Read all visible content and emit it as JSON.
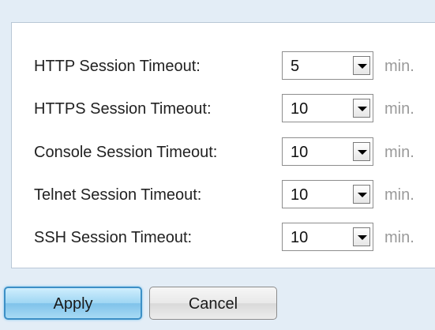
{
  "settings": {
    "rows": [
      {
        "label": "HTTP Session Timeout:",
        "value": "5",
        "unit": "min."
      },
      {
        "label": "HTTPS Session Timeout:",
        "value": "10",
        "unit": "min."
      },
      {
        "label": "Console Session Timeout:",
        "value": "10",
        "unit": "min."
      },
      {
        "label": "Telnet Session Timeout:",
        "value": "10",
        "unit": "min."
      },
      {
        "label": "SSH Session Timeout:",
        "value": "10",
        "unit": "min."
      }
    ]
  },
  "actions": {
    "apply_label": "Apply",
    "cancel_label": "Cancel"
  },
  "icons": {
    "dropdown": "chevron-down-icon"
  },
  "colors": {
    "background": "#e3edf6",
    "panel": "#ffffff",
    "apply_button": "#9fd6f3",
    "unit_text": "#9a9a9a"
  }
}
